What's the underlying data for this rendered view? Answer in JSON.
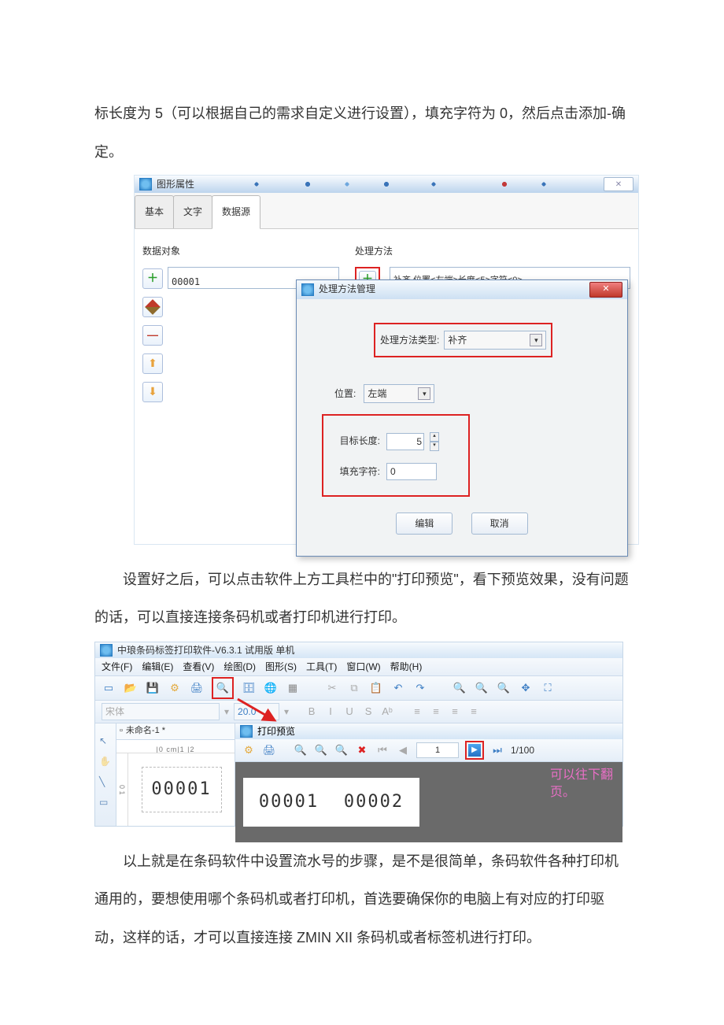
{
  "paragraphs": {
    "p1": "标长度为 5（可以根据自己的需求自定义进行设置），填充字符为 0，然后点击添加-确定。",
    "p2": "设置好之后，可以点击软件上方工具栏中的\"打印预览\"，看下预览效果，没有问题的话，可以直接连接条码机或者打印机进行打印。",
    "p3": "以上就是在条码软件中设置流水号的步骤，是不是很简单，条码软件各种打印机通用的，要想使用哪个条码机或者打印机，首选要确保你的电脑上有对应的打印驱动，这样的话，才可以直接连接 ZMIN XII 条码机或者标签机进行打印。"
  },
  "shot1": {
    "window_title": "图形属性",
    "close_glyph": "✕",
    "tabs": {
      "t1": "基本",
      "t2": "文字",
      "t3": "数据源"
    },
    "left_label": "数据对象",
    "data_value": "00001",
    "right_label": "处理方法",
    "rule_text": "补齐,位置<左端>长度<5>字符<0>",
    "inner": {
      "title": "处理方法管理",
      "close_glyph": "✕",
      "type_label": "处理方法类型:",
      "type_value": "补齐",
      "pos_label": "位置:",
      "pos_value": "左端",
      "len_label": "目标长度:",
      "len_value": "5",
      "fill_label": "填充字符:",
      "fill_value": "0",
      "btn_edit": "编辑",
      "btn_cancel": "取消"
    }
  },
  "shot2": {
    "app_title": "中琅条码标签打印软件-V6.3.1 试用版 单机",
    "menu": {
      "file": "文件(F)",
      "edit": "编辑(E)",
      "view": "查看(V)",
      "draw": "绘图(D)",
      "shape": "图形(S)",
      "tool": "工具(T)",
      "window": "窗口(W)",
      "help": "帮助(H)"
    },
    "font_placeholder": "宋体",
    "font_size": "20.0",
    "styles": {
      "b": "B",
      "i": "I",
      "u": "U",
      "s": "S"
    },
    "doc_tab": "未命名-1 *",
    "ruler_text": "|0 cm|1       |2        ",
    "ruler_v_text": "0      1",
    "label_value": "00001",
    "preview": {
      "title": "打印预览",
      "page_field": "1",
      "page_total": "1/100",
      "labels": {
        "l1": "00001",
        "l2": "00002"
      },
      "pink_note_l1": "可以往下翻",
      "pink_note_l2": "页。"
    }
  }
}
